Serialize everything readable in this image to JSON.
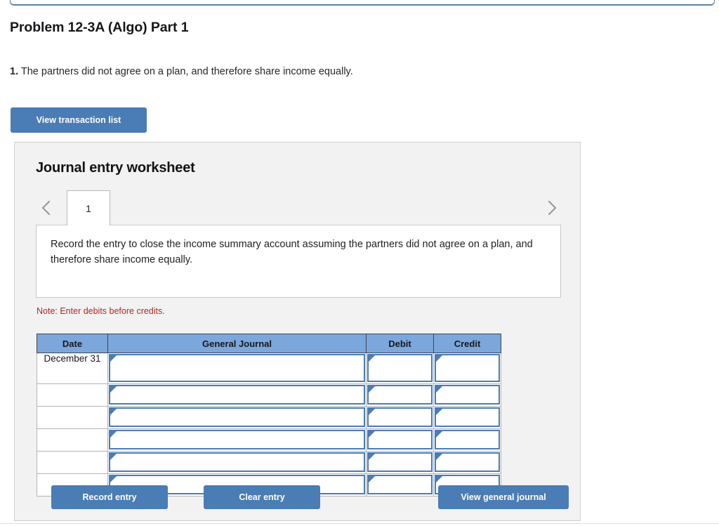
{
  "page": {
    "title": "Problem 12-3A (Algo) Part 1",
    "requirement_number": "1.",
    "requirement_text": " The partners did not agree on a plan, and therefore share income equally."
  },
  "toolbar": {
    "view_transaction_list_label": "View transaction list"
  },
  "worksheet": {
    "title": "Journal entry worksheet",
    "prev_arrow_icon": "chevron-left-icon",
    "next_arrow_icon": "chevron-right-icon",
    "tabs": [
      {
        "label": "1",
        "active": true
      }
    ],
    "description": "Record the entry to close the income summary account assuming the partners did not agree on a plan, and therefore share income equally.",
    "note": "Note: Enter debits before credits.",
    "note_color": "#ae2a24",
    "accent_color": "#4a7cb5",
    "header_color": "#7ba7dc",
    "panel_background": "#f2f2f2"
  },
  "journal": {
    "columns": [
      "Date",
      "General Journal",
      "Debit",
      "Credit"
    ],
    "rows": [
      {
        "date": "December 31",
        "general_journal": "",
        "debit": "",
        "credit": ""
      },
      {
        "date": "",
        "general_journal": "",
        "debit": "",
        "credit": ""
      },
      {
        "date": "",
        "general_journal": "",
        "debit": "",
        "credit": ""
      },
      {
        "date": "",
        "general_journal": "",
        "debit": "",
        "credit": ""
      },
      {
        "date": "",
        "general_journal": "",
        "debit": "",
        "credit": ""
      },
      {
        "date": "",
        "general_journal": "",
        "debit": "",
        "credit": ""
      }
    ]
  },
  "actions": {
    "record_entry_label": "Record entry",
    "clear_entry_label": "Clear entry",
    "view_general_journal_label": "View general journal"
  }
}
